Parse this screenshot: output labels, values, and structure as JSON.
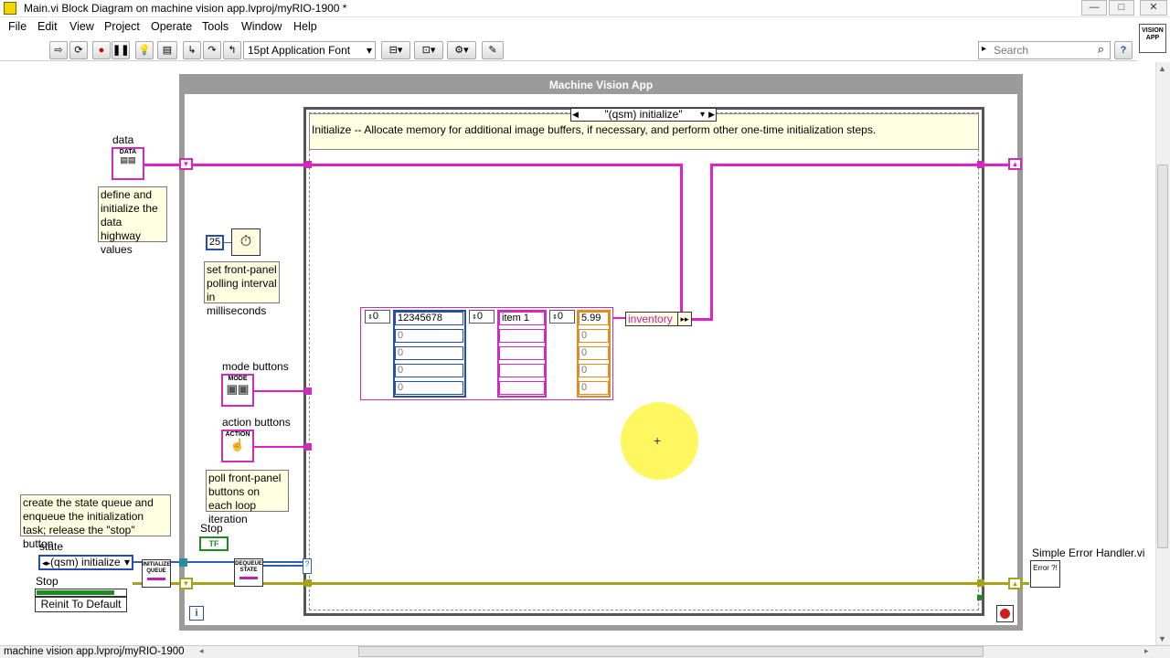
{
  "window": {
    "title": "Main.vi Block Diagram on machine vision app.lvproj/myRIO-1900 *",
    "minimize": "—",
    "maximize": "□",
    "close": "✕"
  },
  "menu": [
    "File",
    "Edit",
    "View",
    "Project",
    "Operate",
    "Tools",
    "Window",
    "Help"
  ],
  "toolbar": {
    "font": "15pt Application Font",
    "search_placeholder": "Search",
    "help": "?",
    "vision_icon": "VISION APP"
  },
  "diagram": {
    "loop_title": "Machine Vision App",
    "case_selector": "\"(qsm) initialize\"",
    "case_comment": "Initialize -- Allocate memory for additional image buffers, if necessary, and perform other one-time initialization steps.",
    "data_label": "data",
    "data_icon": "DATA",
    "data_note": "define and initialize the data highway values",
    "poll_constant": "25",
    "poll_note": "set front-panel polling interval in milliseconds",
    "mode_label": "mode buttons",
    "mode_icon": "MODE",
    "action_label": "action buttons",
    "action_icon": "ACTION",
    "buttons_note": "poll front-panel buttons on each loop iteration",
    "state_note": "create the state queue and enqueue the initialization task; release the \"stop\" button",
    "state_label": "state",
    "state_value": "(qsm) initialize",
    "stop_label": "Stop",
    "reinit_label": "Reinit To Default",
    "stop_label_2": "Stop",
    "tf": "TF",
    "init_queue": "INITIALIZE QUEUE",
    "dequeue": "DEQUEUE STATE",
    "iteration": "i",
    "error_handler_label": "Simple Error Handler.vi",
    "error_icon": "Error ?!",
    "inventory_label": "inventory",
    "array": {
      "index_values": [
        "0",
        "0",
        "0",
        "0"
      ],
      "col1": [
        "12345678",
        "0",
        "0",
        "0",
        "0"
      ],
      "col2": [
        "item 1",
        "",
        "",
        "",
        ""
      ],
      "col3": [
        "5.99",
        "0",
        "0",
        "0",
        "0"
      ]
    }
  },
  "status": {
    "project": "machine vision app.lvproj/myRIO-1900"
  }
}
